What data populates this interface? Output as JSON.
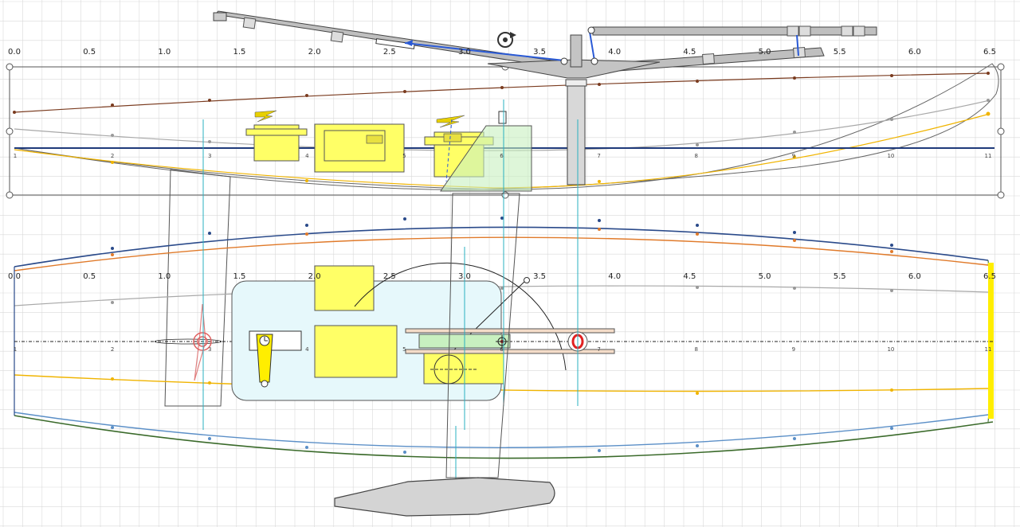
{
  "ruler_labels": [
    "0.0",
    "0.5",
    "1.0",
    "1.5",
    "2.0",
    "2.5",
    "3.0",
    "3.5",
    "4.0",
    "4.5",
    "5.0",
    "5.5",
    "6.0",
    "6.5"
  ],
  "station_labels": [
    "1",
    "2",
    "3",
    "4",
    "5",
    "6",
    "7",
    "8",
    "9",
    "10",
    "11"
  ],
  "colors": {
    "grid": "#d9d9d9",
    "sheer": "#7a3b1f",
    "deck_grey": "#a8a8a8",
    "waterline": "#1f3a7a",
    "keel_yellow": "#f0b400",
    "side_navy": "#2a4a8a",
    "side_orange": "#e07a2a",
    "chine_blue": "#5b8fc7",
    "keel_green": "#3a6a2a",
    "component_yellow": "#ffff66",
    "tray_cyan": "#e6f8fb",
    "rig_grey": "#bfbfbf",
    "rig_blue": "#2a5ad6",
    "red": "#e02020",
    "cyan_line": "#2ab0c0"
  },
  "icons": [
    "rotate-icon",
    "lightning-icon",
    "propeller-icon",
    "target-icon",
    "servo-arm-icon"
  ]
}
